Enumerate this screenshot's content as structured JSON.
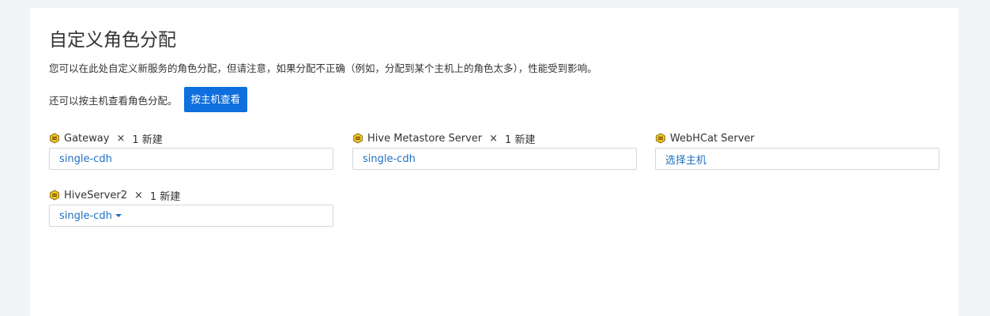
{
  "page": {
    "title": "自定义角色分配",
    "description": "您可以在此处自定义新服务的角色分配，但请注意，如果分配不正确（例如，分配到某个主机上的角色太多），性能受到影响。",
    "view_by_host_text": "还可以按主机查看角色分配。",
    "view_by_host_button": "按主机查看"
  },
  "roles": [
    {
      "name": "Gateway",
      "times": "×",
      "count": "1 新建",
      "host": "single-cdh",
      "icon": "hive-bee-icon"
    },
    {
      "name": "Hive Metastore Server",
      "times": "×",
      "count": "1 新建",
      "host": "single-cdh",
      "icon": "hive-bee-icon"
    },
    {
      "name": "WebHCat Server",
      "host": "选择主机",
      "icon": "hive-bee-icon"
    },
    {
      "name": "HiveServer2",
      "times": "×",
      "count": "1 新建",
      "host": "single-cdh",
      "icon": "hive-bee-icon",
      "dropdown": true
    }
  ],
  "colors": {
    "accent": "#0f6fde",
    "link": "#1f6fbf",
    "background": "#f3f4f6",
    "bee_yellow": "#f3c623"
  }
}
